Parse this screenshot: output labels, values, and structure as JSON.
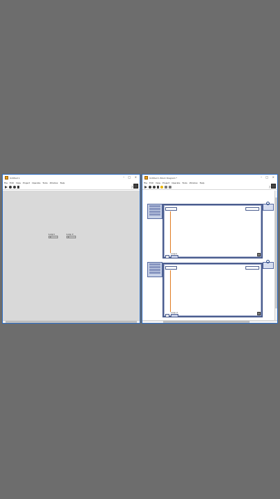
{
  "front_panel": {
    "title": "Untitled 1",
    "menu": [
      "File",
      "Edit",
      "View",
      "Project",
      "Operate",
      "Tools",
      "Window",
      "Help"
    ],
    "help_glyph": "?",
    "indicators": [
      {
        "label": "Loop1",
        "value": "0"
      },
      {
        "label": "Loop 2",
        "value": "0"
      }
    ]
  },
  "block_diagram": {
    "title": "Untitled 1 Block Diagram *",
    "menu": [
      "File",
      "Edit",
      "View",
      "Project",
      "Operate",
      "Tools",
      "Window",
      "Help"
    ],
    "help_glyph": "?",
    "loop1": {
      "label": "Loop1",
      "i_terminal": "i",
      "count_label": "Loop1"
    },
    "loop2": {
      "label": "Loop 2",
      "i_terminal": "i",
      "count_label": "Loop 2"
    }
  },
  "window_controls": {
    "minimize": "–",
    "maximize": "□",
    "close": "×"
  },
  "colors": {
    "window_border": "#2b6cc4",
    "loop_border": "#4b5d8e",
    "panel_bg": "#d9d9d9",
    "desktop_bg": "#6d6d6d"
  },
  "icons": [
    "labview-app-icon",
    "run-arrow-icon",
    "run-continuous-icon",
    "abort-icon",
    "pause-icon",
    "context-help-icon"
  ]
}
